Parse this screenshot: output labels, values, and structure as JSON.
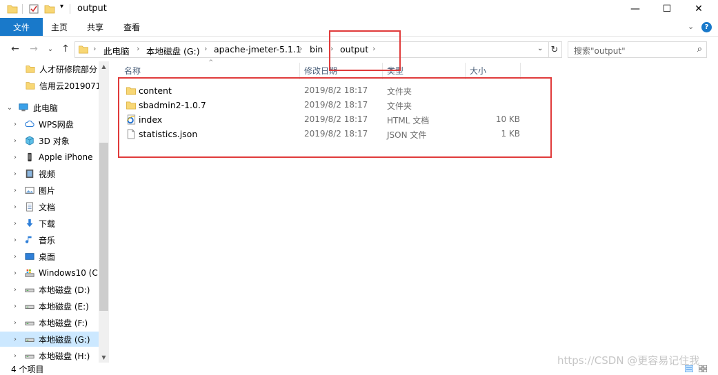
{
  "window": {
    "title": "output",
    "controls": {
      "minimize": "—",
      "maximize": "☐",
      "close": "✕"
    }
  },
  "ribbon": {
    "tabs": [
      "文件",
      "主页",
      "共享",
      "查看"
    ],
    "expand": "⌄",
    "help": "?"
  },
  "nav": {
    "back": "←",
    "forward": "→",
    "recent": "⌄",
    "up": "↑"
  },
  "address": {
    "crumbs": [
      "此电脑",
      "本地磁盘 (G:)",
      "apache-jmeter-5.1.1",
      "bin",
      "output"
    ],
    "sep": "›",
    "dropdown": "⌄",
    "refresh": "↻"
  },
  "search": {
    "placeholder": "搜索\"output\"",
    "icon": "⌕"
  },
  "sidebar": {
    "items": [
      {
        "label": "人才研修院部分",
        "icon": "folder-icon",
        "arrow": ""
      },
      {
        "label": "信用云2019071",
        "icon": "folder-icon",
        "arrow": ""
      },
      {
        "label": "此电脑",
        "icon": "pc-icon",
        "arrow": "⌄"
      },
      {
        "label": "WPS网盘",
        "icon": "cloud-icon",
        "arrow": "›"
      },
      {
        "label": "3D 对象",
        "icon": "cube-icon",
        "arrow": "›"
      },
      {
        "label": "Apple iPhone",
        "icon": "phone-icon",
        "arrow": "›"
      },
      {
        "label": "视频",
        "icon": "video-icon",
        "arrow": "›"
      },
      {
        "label": "图片",
        "icon": "picture-icon",
        "arrow": "›"
      },
      {
        "label": "文档",
        "icon": "document-icon",
        "arrow": "›"
      },
      {
        "label": "下载",
        "icon": "download-icon",
        "arrow": "›"
      },
      {
        "label": "音乐",
        "icon": "music-icon",
        "arrow": "›"
      },
      {
        "label": "桌面",
        "icon": "desktop-icon",
        "arrow": "›"
      },
      {
        "label": "Windows10 (C:",
        "icon": "system-drive-icon",
        "arrow": "›"
      },
      {
        "label": "本地磁盘 (D:)",
        "icon": "drive-icon",
        "arrow": "›"
      },
      {
        "label": "本地磁盘 (E:)",
        "icon": "drive-icon",
        "arrow": "›"
      },
      {
        "label": "本地磁盘 (F:)",
        "icon": "drive-icon",
        "arrow": "›"
      },
      {
        "label": "本地磁盘 (G:)",
        "icon": "drive-icon",
        "arrow": "›"
      },
      {
        "label": "本地磁盘 (H:)",
        "icon": "drive-icon",
        "arrow": "›"
      }
    ],
    "selected_index": 16,
    "scroll_up": "▲",
    "scroll_down": "▼"
  },
  "columns": {
    "name": "名称",
    "date": "修改日期",
    "type": "类型",
    "size": "大小",
    "sort_arrow": "^"
  },
  "files": [
    {
      "name": "content",
      "date": "2019/8/2 18:17",
      "type": "文件夹",
      "size": "",
      "icon": "folder-icon"
    },
    {
      "name": "sbadmin2-1.0.7",
      "date": "2019/8/2 18:17",
      "type": "文件夹",
      "size": "",
      "icon": "folder-icon"
    },
    {
      "name": "index",
      "date": "2019/8/2 18:17",
      "type": "HTML 文档",
      "size": "10 KB",
      "icon": "ie-html-icon"
    },
    {
      "name": "statistics.json",
      "date": "2019/8/2 18:17",
      "type": "JSON 文件",
      "size": "1 KB",
      "icon": "file-icon"
    }
  ],
  "status": {
    "count": "4 个项目"
  },
  "watermark": "https://CSDN @更容易记住我",
  "colors": {
    "accent": "#1979ca",
    "selection": "#cce8ff",
    "folder": "#f8d775",
    "annotation": "#e03a3a"
  }
}
